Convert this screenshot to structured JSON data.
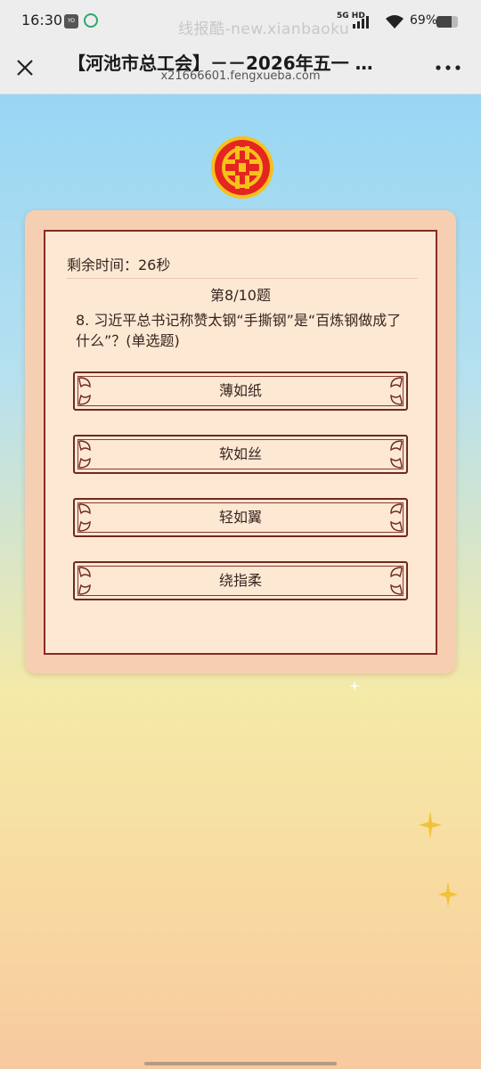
{
  "status_bar": {
    "time": "16:30",
    "network": "5G HD",
    "watermark": "线报酷-new.xianbaoku",
    "battery_text": "69%",
    "battery_level": 0.69
  },
  "titlebar": {
    "title": "【河池市总工会】－－2026年五一 …",
    "url": "x21666601.fengxueba.com"
  },
  "quiz": {
    "timer": "剩余时间：26秒",
    "progress": "第8/10题",
    "question": "8. 习近平总书记称赞太钢“手撕钢”是“百炼钢做成了什么”？(单选题)",
    "options": [
      "薄如纸",
      "软如丝",
      "轻如翼",
      "绕指柔"
    ]
  },
  "colors": {
    "card_outer": "#f6cfb2",
    "card_inner": "#fce8d3",
    "border_red": "#8a2a22",
    "emblem_red": "#e52521",
    "emblem_gold": "#f6c11b"
  }
}
